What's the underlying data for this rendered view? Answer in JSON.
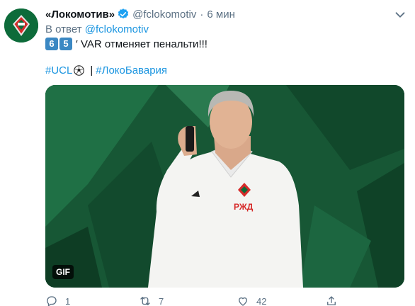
{
  "tweet": {
    "author_name": "«Локомотив»",
    "handle": "@fclokomotiv",
    "separator": "·",
    "time": "6 мин",
    "reply_prefix": "В ответ",
    "reply_handle": "@fclokomotiv",
    "keycap_1": "6",
    "keycap_2": "5",
    "text": "′ VAR отменяет пенальти!!!",
    "hashtag_1": "#UCL",
    "hashtag_sep": "|",
    "hashtag_2": "#ЛокоБавария",
    "media_badge": "GIF"
  },
  "actions": {
    "reply_count": "1",
    "retweet_count": "7",
    "like_count": "42"
  },
  "colors": {
    "link": "#1b95e0",
    "secondary": "#5b7083",
    "verified": "#1da1f2",
    "brand_green": "#0d6b3a"
  },
  "icons": [
    "logo-avatar",
    "verified-icon",
    "chevron-down-icon",
    "keycap-icon",
    "soccer-ball-icon",
    "reply-icon",
    "retweet-icon",
    "like-icon",
    "share-icon"
  ]
}
